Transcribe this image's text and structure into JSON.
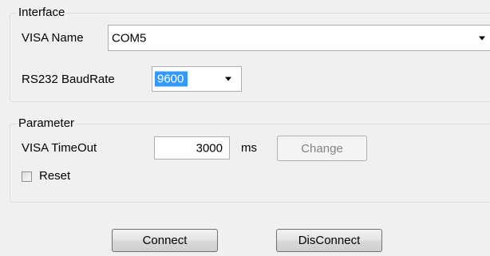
{
  "interface": {
    "legend": "Interface",
    "visa_name_label": "VISA Name",
    "visa_name_value": "COM5",
    "baud_label": "RS232 BaudRate",
    "baud_value": "9600"
  },
  "parameter": {
    "legend": "Parameter",
    "timeout_label": "VISA TimeOut",
    "timeout_value": "3000",
    "timeout_unit": "ms",
    "change_label": "Change",
    "reset_label": "Reset",
    "reset_checked": false
  },
  "actions": {
    "connect_label": "Connect",
    "disconnect_label": "DisConnect"
  },
  "colors": {
    "selection_highlight": "#3399ff",
    "group_border": "#d5dfe5",
    "background": "#f0f0f0"
  },
  "icons": {
    "combo_arrow": "chevron-down-icon",
    "checkbox": "checkbox-unchecked-icon"
  }
}
